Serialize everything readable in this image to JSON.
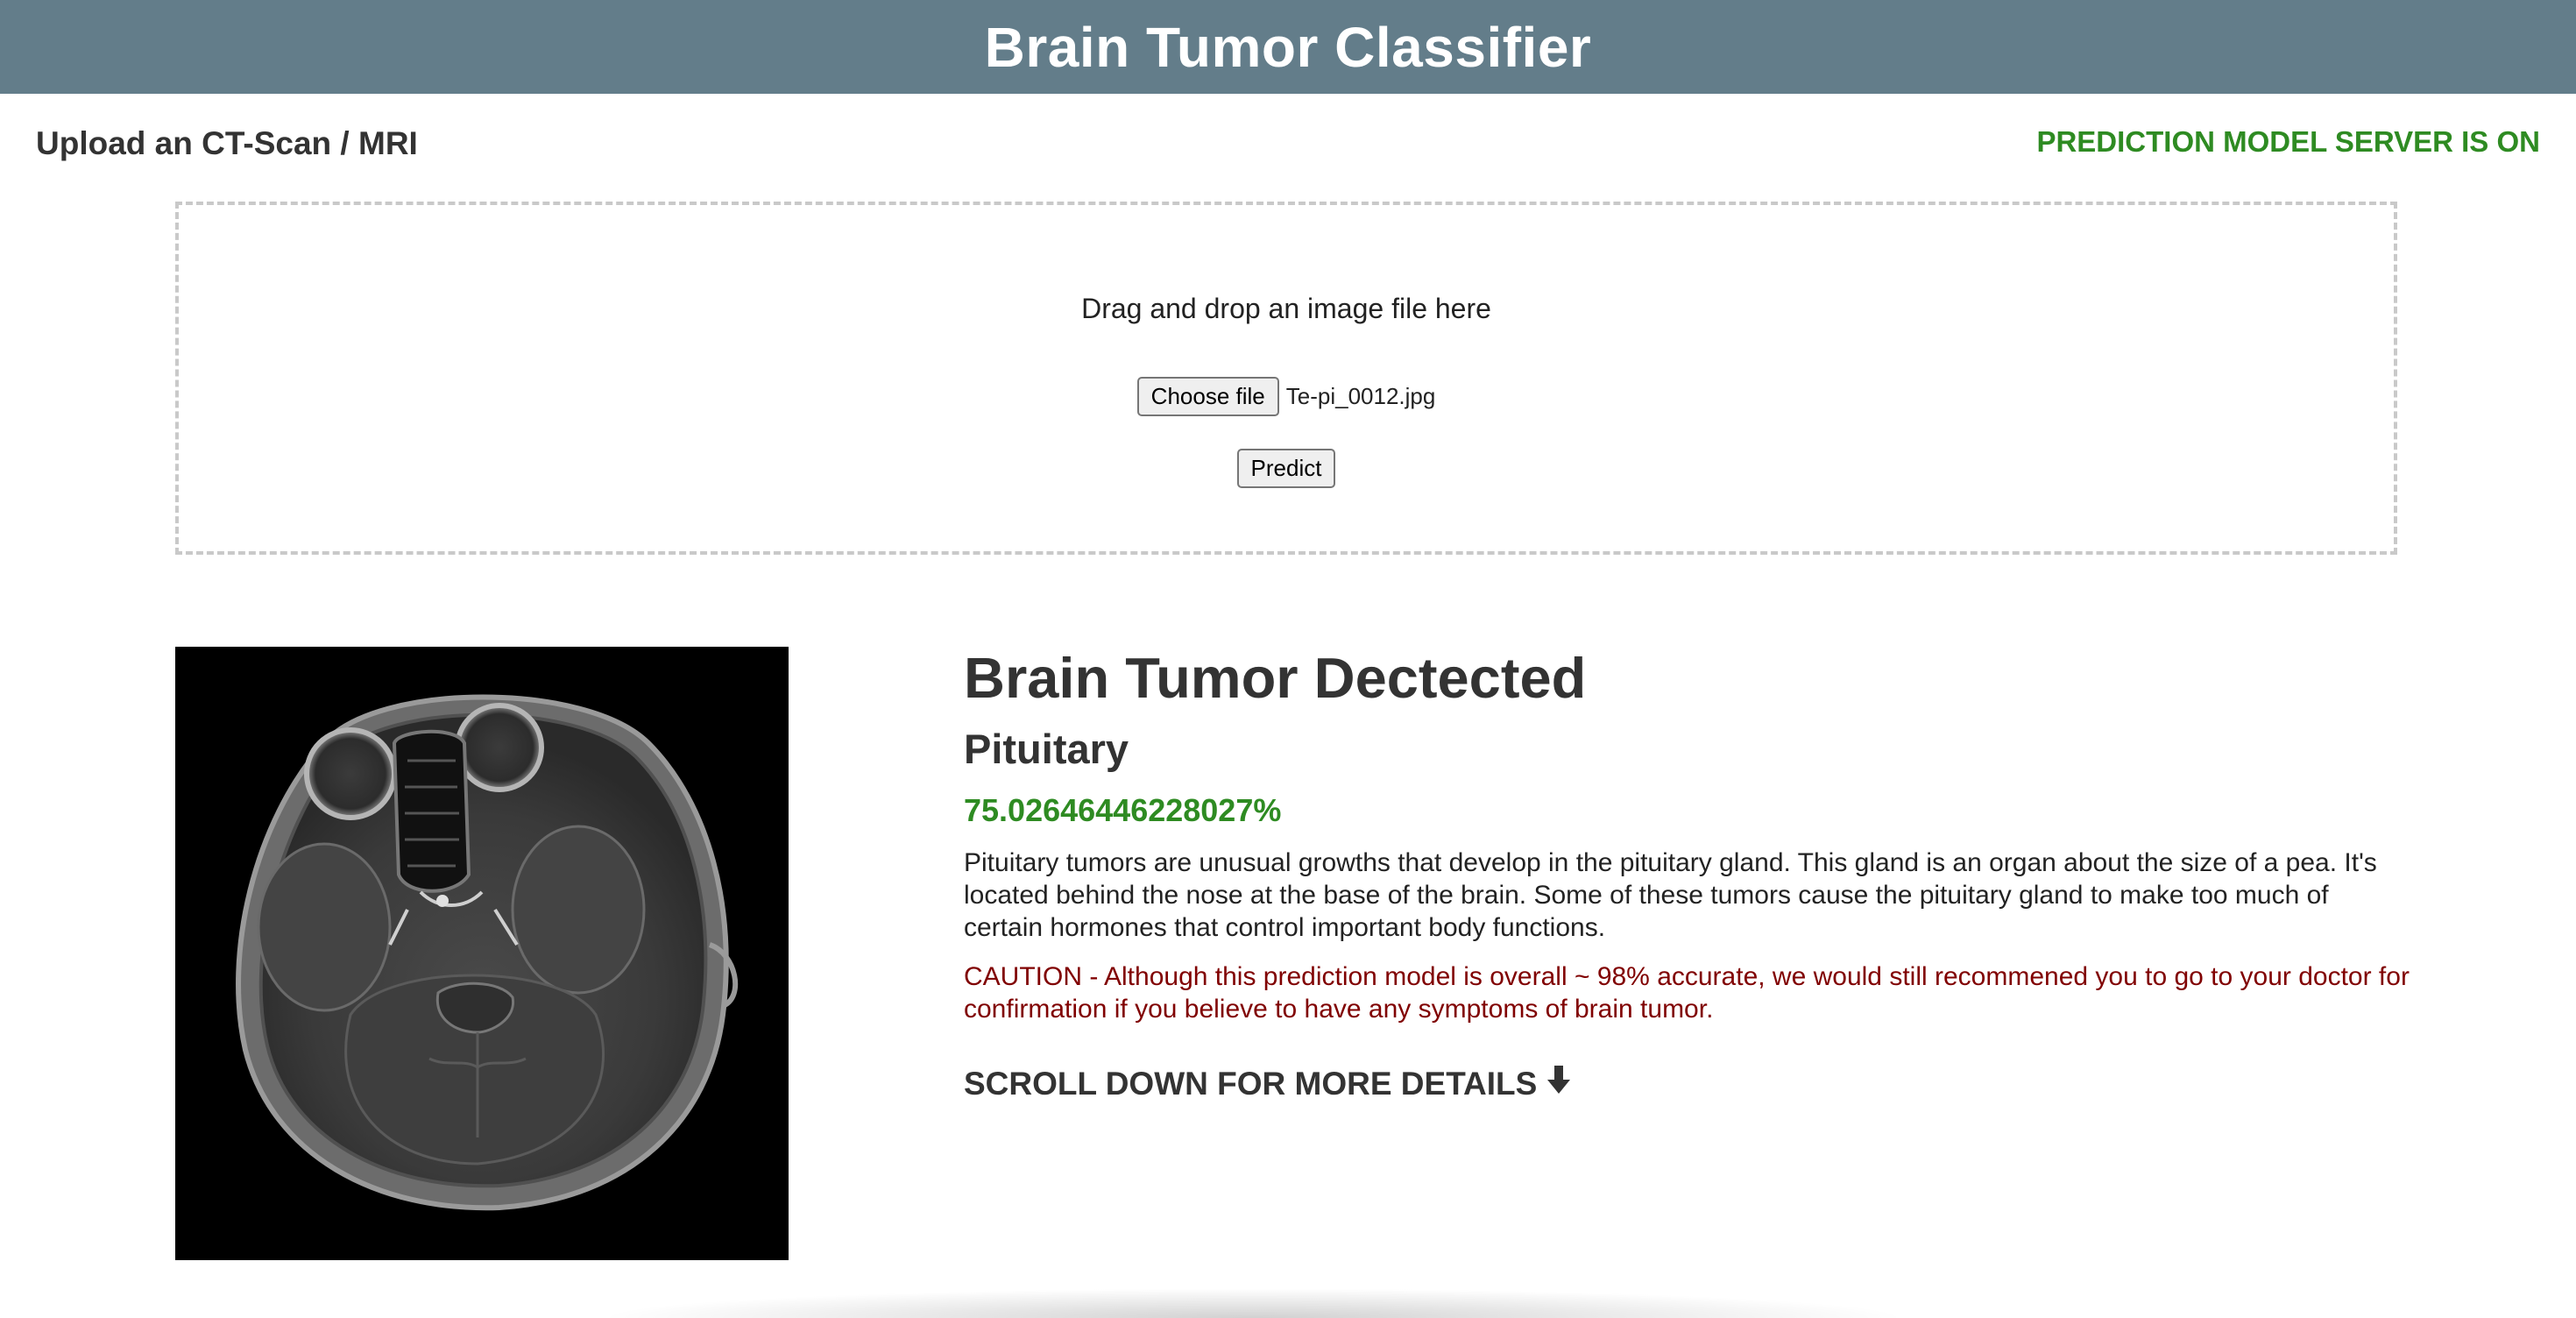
{
  "header": {
    "title": "Brain Tumor Classifier"
  },
  "upload": {
    "heading": "Upload an CT-Scan / MRI",
    "server_status": "PREDICTION MODEL SERVER IS ON",
    "drop_text": "Drag and drop an image file here",
    "choose_file_label": "Choose file",
    "file_name": "Te-pi_0012.jpg",
    "predict_label": "Predict"
  },
  "result": {
    "title": "Brain Tumor Dectected",
    "class_name": "Pituitary",
    "confidence": "75.02646446228027%",
    "description": "Pituitary tumors are unusual growths that develop in the pituitary gland. This gland is an organ about the size of a pea. It's located behind the nose at the base of the brain. Some of these tumors cause the pituitary gland to make too much of certain hormones that control important body functions.",
    "caution": "CAUTION - Although this prediction model is overall ~ 98% accurate, we would still recommened you to go to your doctor for confirmation if you believe to have any symptoms of brain tumor.",
    "scroll_hint": "SCROLL DOWN FOR MORE DETAILS",
    "scroll_icon": "down-arrow-icon"
  },
  "colors": {
    "header_bg": "#637d8a",
    "status_green": "#2e8b22",
    "caution_red": "#800000"
  }
}
